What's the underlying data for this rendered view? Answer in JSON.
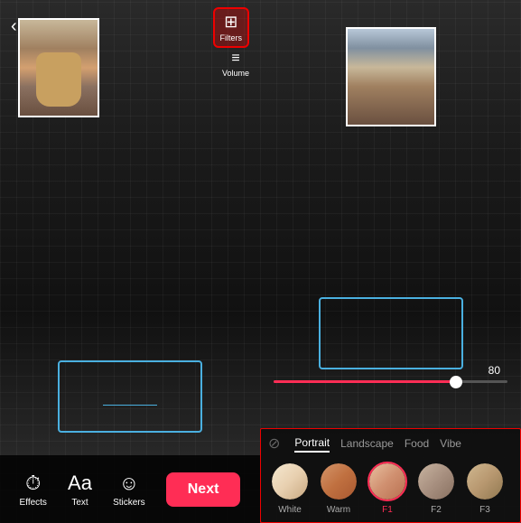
{
  "left_panel": {
    "back_arrow": "‹",
    "filters_button": {
      "icon": "⚙",
      "label": "Filters"
    },
    "volume_button": {
      "icon": "≡",
      "label": "Volume"
    },
    "toolbar": {
      "effects_label": "Effects",
      "text_label": "Text",
      "stickers_label": "Stickers",
      "next_label": "Next"
    }
  },
  "right_panel": {
    "slider": {
      "value": "80",
      "percent": 78
    },
    "filter_tabs": [
      {
        "label": "Portrait",
        "active": true
      },
      {
        "label": "Landscape",
        "active": false
      },
      {
        "label": "Food",
        "active": false
      },
      {
        "label": "Vibe",
        "active": false
      }
    ],
    "filters": [
      {
        "name": "White",
        "face_class": "face-white",
        "active": false
      },
      {
        "name": "Warm",
        "face_class": "face-warm",
        "active": false
      },
      {
        "name": "F1",
        "face_class": "face-f1",
        "active": true
      },
      {
        "name": "F2",
        "face_class": "face-f2",
        "active": false
      },
      {
        "name": "F3",
        "face_class": "face-f3",
        "active": false
      }
    ]
  }
}
